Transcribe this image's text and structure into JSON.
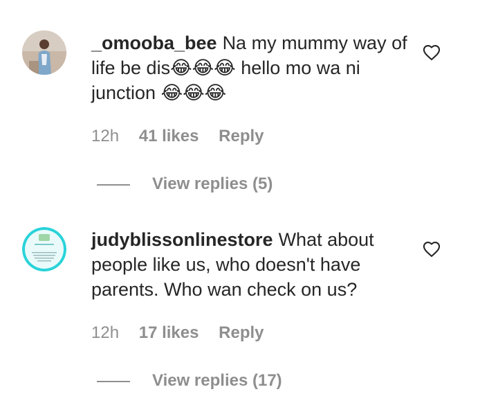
{
  "comments": [
    {
      "username": "_omooba_bee",
      "text": "Na my mummy way of life be dis😂😂😂 hello mo wa ni junction 😂😂😂",
      "time": "12h",
      "likes": "41 likes",
      "reply_label": "Reply",
      "view_replies": "View replies (5)",
      "avatar_icon": "profile-photo",
      "like_icon": "heart-outline-icon"
    },
    {
      "username": "judyblissonlinestore",
      "text": "What about people like us, who doesn't have parents. Who wan check on us?",
      "time": "12h",
      "likes": "17 likes",
      "reply_label": "Reply",
      "view_replies": "View replies (17)",
      "avatar_icon": "store-logo",
      "like_icon": "heart-outline-icon"
    }
  ],
  "colors": {
    "text": "#262626",
    "muted": "#8e8e8e",
    "background": "#ffffff",
    "avatar2_ring": "#29d3d9"
  }
}
